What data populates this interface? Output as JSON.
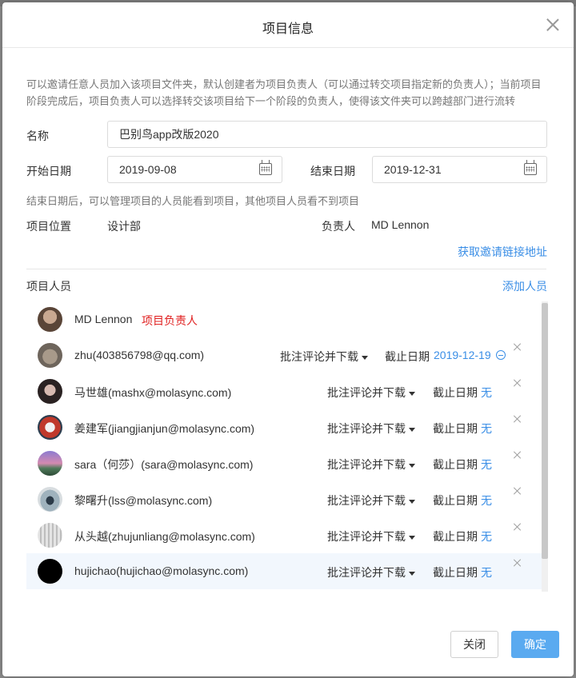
{
  "modal": {
    "title": "项目信息",
    "description": "可以邀请任意人员加入该项目文件夹，默认创建者为项目负责人（可以通过转交项目指定新的负责人）；当前项目阶段完成后，项目负责人可以选择转交该项目给下一个阶段的负责人，使得该文件夹可以跨越部门进行流转"
  },
  "form": {
    "name_label": "名称",
    "name_value": "巴别鸟app改版2020",
    "start_label": "开始日期",
    "start_value": "2019-09-08",
    "end_label": "结束日期",
    "end_value": "2019-12-31",
    "end_note": "结束日期后，可以管理项目的人员能看到项目，其他项目人员看不到项目",
    "location_label": "项目位置",
    "location_value": "设计部",
    "owner_label": "负责人",
    "owner_value": "MD Lennon",
    "invite_link": "获取邀请链接地址"
  },
  "members_section": {
    "title": "项目人员",
    "add_link": "添加人员",
    "owner_tag": "项目负责人",
    "deadline_label": "截止日期",
    "items": [
      {
        "name": "MD Lennon",
        "is_owner": true,
        "avatar_color": "#6b5a4e"
      },
      {
        "name": "zhu(403856798@qq.com)",
        "permission": "批注评论并下载",
        "deadline": "2019-12-19",
        "avatar_color": "#8a7f74"
      },
      {
        "name": "马世雄(mashx@molasync.com)",
        "permission": "批注评论并下载",
        "deadline": "无",
        "avatar_color": "#3c2f30"
      },
      {
        "name": "姜建军(jiangjianjun@molasync.com)",
        "permission": "批注评论并下载",
        "deadline": "无",
        "avatar_color": "#b04a3a"
      },
      {
        "name": "sara（何莎）(sara@molasync.com)",
        "permission": "批注评论并下载",
        "deadline": "无",
        "avatar_color": "#9a6fa8"
      },
      {
        "name": "黎曙升(lss@molasync.com)",
        "permission": "批注评论并下载",
        "deadline": "无",
        "avatar_color": "#8aa0a8"
      },
      {
        "name": "从头越(zhujunliang@molasync.com)",
        "permission": "批注评论并下载",
        "deadline": "无",
        "avatar_color": "#c8c8c8"
      },
      {
        "name": "hujichao(hujichao@molasync.com)",
        "permission": "批注评论并下载",
        "deadline": "无",
        "avatar_color": "#000000"
      }
    ]
  },
  "footer": {
    "cancel_label": "关闭",
    "ok_label": "确定"
  },
  "colors": {
    "accent": "#3a8ee6",
    "primary_button": "#5aaaf0",
    "owner_tag": "#e02020"
  }
}
